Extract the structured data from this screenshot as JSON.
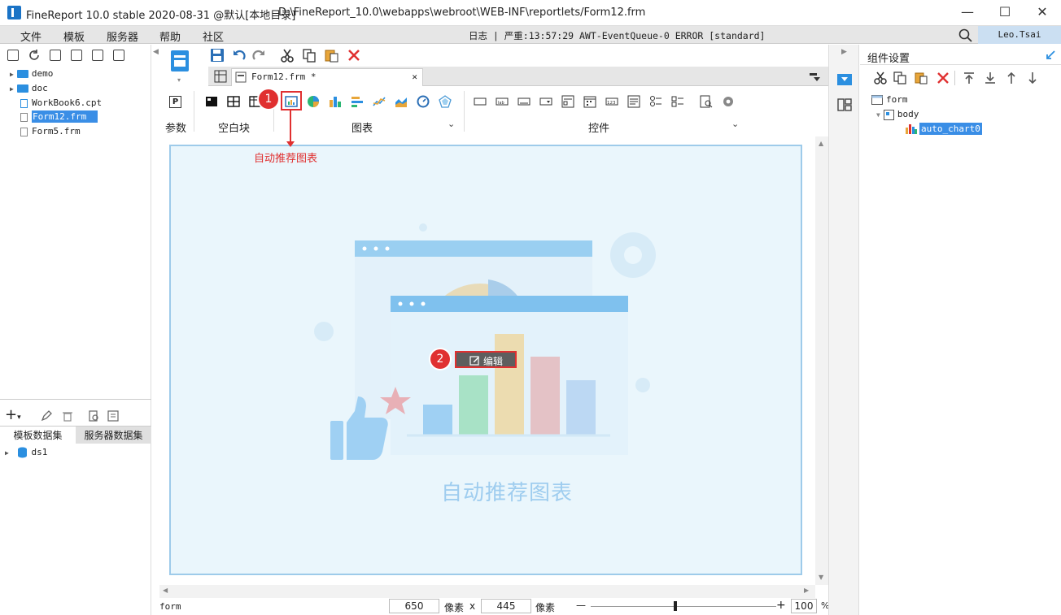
{
  "window": {
    "app_title": "FineReport 10.0 stable 2020-08-31 @默认[本地目录]",
    "file_path": "D:\\FineReport_10.0\\webapps\\webroot\\WEB-INF\\reportlets/Form12.frm",
    "minimize": "—",
    "maximize": "☐",
    "close": "✕"
  },
  "menu": {
    "items": [
      "文件",
      "模板",
      "服务器",
      "帮助",
      "社区"
    ],
    "log_text": "日志 | 严重:13:57:29 AWT-EventQueue-0 ERROR [standard]",
    "user": "Leo.Tsai"
  },
  "file_tree": {
    "items": [
      {
        "label": "demo",
        "type": "folder"
      },
      {
        "label": "doc",
        "type": "folder"
      },
      {
        "label": "WorkBook6.cpt",
        "type": "file"
      },
      {
        "label": "Form12.frm",
        "type": "file",
        "selected": true
      },
      {
        "label": "Form5.frm",
        "type": "file"
      }
    ]
  },
  "dataset_panel": {
    "tabs": [
      "模板数据集",
      "服务器数据集"
    ],
    "items": [
      "ds1"
    ]
  },
  "editor": {
    "tab_label": "Form12.frm *",
    "tab_close": "✕",
    "groups": {
      "param": "参数",
      "blank": "空白块",
      "chart": "图表",
      "widget": "控件"
    },
    "param_icon_letter": "P"
  },
  "callouts": {
    "one": "1",
    "two": "2",
    "annotation": "自动推荐图表"
  },
  "canvas": {
    "edit_button": "编辑",
    "placeholder_title": "自动推荐图表"
  },
  "status": {
    "name": "form",
    "width_value": "650",
    "width_unit": "像素",
    "x": "x",
    "height_value": "445",
    "height_unit": "像素",
    "zoom_minus": "—",
    "zoom_plus": "+",
    "zoom_value": "100",
    "zoom_unit": "%"
  },
  "right_panel": {
    "title": "组件设置",
    "tree": [
      "form",
      "body",
      "auto_chart0"
    ]
  },
  "colors": {
    "accent": "#3a8ee6",
    "callout": "#e03030",
    "canvas_bg": "#eaf6fc"
  }
}
